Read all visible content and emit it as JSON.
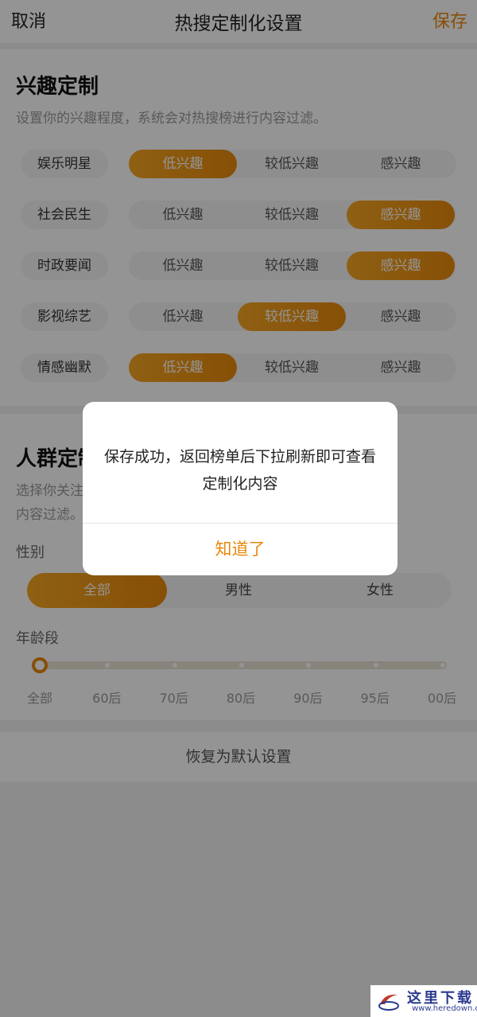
{
  "nav": {
    "cancel": "取消",
    "title": "热搜定制化设置",
    "save": "保存"
  },
  "interest": {
    "title": "兴趣定制",
    "desc": "设置你的兴趣程度，系统会对热搜榜进行内容过滤。",
    "options": [
      "低兴趣",
      "较低兴趣",
      "感兴趣"
    ],
    "rows": [
      {
        "label": "娱乐明星",
        "selected": 0
      },
      {
        "label": "社会民生",
        "selected": 2
      },
      {
        "label": "时政要闻",
        "selected": 2
      },
      {
        "label": "影视综艺",
        "selected": 1
      },
      {
        "label": "情感幽默",
        "selected": 0
      }
    ]
  },
  "crowd": {
    "title": "人群定制",
    "desc_line1": "选择你关注的人群，系统会对热搜榜进行",
    "desc_line2": "内容过滤。",
    "gender_label": "性别",
    "gender_options": [
      "全部",
      "男性",
      "女性"
    ],
    "gender_selected": 0,
    "age_label": "年龄段",
    "age_ticks": [
      "全部",
      "60后",
      "70后",
      "80后",
      "90后",
      "95后",
      "00后"
    ],
    "age_selected": 0
  },
  "reset_label": "恢复为默认设置",
  "dialog": {
    "message": "保存成功，返回榜单后下拉刷新即可查看定制化内容",
    "button": "知道了"
  },
  "watermark": {
    "title": "这里下载",
    "url": "www.heredown.com"
  },
  "colors": {
    "accent": "#e8870f",
    "accent_light": "#f5a623"
  }
}
